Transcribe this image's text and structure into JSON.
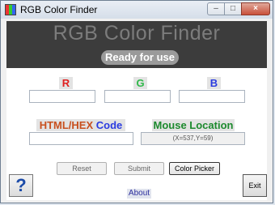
{
  "window": {
    "title": "RGB Color Finder"
  },
  "titlebar": {
    "min_glyph": "–",
    "max_glyph": "□",
    "close_glyph": "×"
  },
  "header": {
    "title": "RGB Color Finder",
    "status": "Ready for use"
  },
  "fields": {
    "r_label": "R",
    "g_label": "G",
    "b_label": "B",
    "r_value": "",
    "g_value": "",
    "b_value": "",
    "hex_label_part1": "HTML/HEX",
    "hex_label_part2": "Code",
    "hex_value": "",
    "mouse_label": "Mouse Location",
    "mouse_value": "(X=537,Y=59)"
  },
  "buttons": {
    "reset": "Reset",
    "submit": "Submit",
    "color_picker": "Color Picker",
    "help": "?",
    "exit": "Exit",
    "about": "About"
  },
  "colors": {
    "r": "#e02020",
    "g": "#2fb84a",
    "b": "#2a3be0",
    "hex": "#c8501e",
    "code": "#2a3be0",
    "mouse": "#1d8a2e"
  },
  "icons": {
    "app": "rgb-app-icon",
    "help": "help-icon"
  }
}
